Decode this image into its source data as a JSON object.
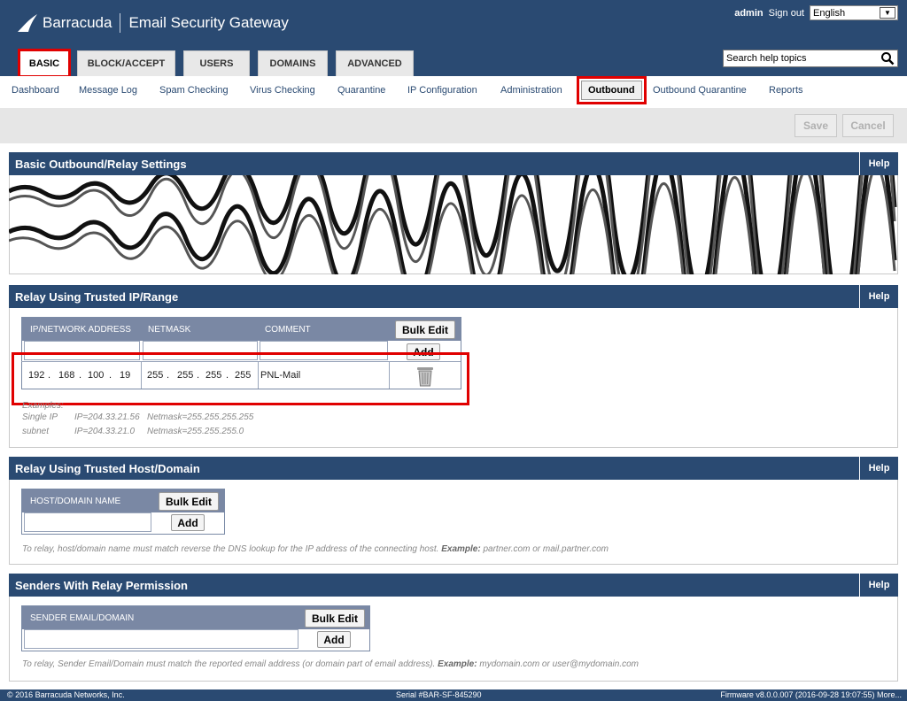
{
  "header": {
    "brand": "Barracuda",
    "product": "Email Security Gateway",
    "user": "admin",
    "signout": "Sign out",
    "language": "English",
    "help_search": "Search help topics",
    "colors": {
      "header_bg": "#2a4a72",
      "highlight": "#e00000"
    }
  },
  "tabs": [
    {
      "label": "BASIC",
      "active": true
    },
    {
      "label": "BLOCK/ACCEPT"
    },
    {
      "label": "USERS"
    },
    {
      "label": "DOMAINS"
    },
    {
      "label": "ADVANCED"
    }
  ],
  "subnav": [
    {
      "label": "Dashboard"
    },
    {
      "label": "Message Log"
    },
    {
      "label": "Spam Checking"
    },
    {
      "label": "Virus Checking"
    },
    {
      "label": "Quarantine"
    },
    {
      "label": "IP Configuration"
    },
    {
      "label": "Administration"
    },
    {
      "label": "Outbound",
      "active": true
    },
    {
      "label": "Outbound Quarantine"
    },
    {
      "label": "Reports"
    }
  ],
  "toolbar": {
    "save": "Save",
    "cancel": "Cancel"
  },
  "sections": {
    "basic": {
      "title": "Basic Outbound/Relay Settings",
      "help": "Help"
    },
    "trusted_ip": {
      "title": "Relay Using Trusted IP/Range",
      "help": "Help",
      "col_ip": "IP/NETWORK ADDRESS",
      "col_mask": "NETMASK",
      "col_comment": "COMMENT",
      "bulk": "Bulk Edit",
      "add": "Add",
      "row": {
        "ip": [
          "192",
          "168",
          "100",
          "19"
        ],
        "mask": [
          "255",
          "255",
          "255",
          "255"
        ],
        "comment": "PNL-Mail"
      },
      "examples_label": "Examples:",
      "ex1_type": "Single IP",
      "ex1_ip": "IP=204.33.21.56",
      "ex1_mask": "Netmask=255.255.255.255",
      "ex2_type": "subnet",
      "ex2_ip": "IP=204.33.21.0",
      "ex2_mask": "Netmask=255.255.255.0"
    },
    "trusted_host": {
      "title": "Relay Using Trusted Host/Domain",
      "help": "Help",
      "col": "HOST/DOMAIN NAME",
      "bulk": "Bulk Edit",
      "add": "Add",
      "note": "To relay, host/domain name must match reverse the DNS lookup for the IP address of the connecting host.",
      "note_example_label": "Example:",
      "note_example": "partner.com or mail.partner.com"
    },
    "senders": {
      "title": "Senders With Relay Permission",
      "help": "Help",
      "col": "SENDER EMAIL/DOMAIN",
      "bulk": "Bulk Edit",
      "add": "Add",
      "note": "To relay, Sender Email/Domain must match the reported email address (or domain part of email address).",
      "note_example_label": "Example:",
      "note_example": "mydomain.com or user@mydomain.com"
    }
  },
  "footer": {
    "copyright": "© 2016 Barracuda Networks, Inc.",
    "serial": "Serial #BAR-SF-845290",
    "firmware": "Firmware v8.0.0.007 (2016-09-28 19:07:55) More..."
  }
}
